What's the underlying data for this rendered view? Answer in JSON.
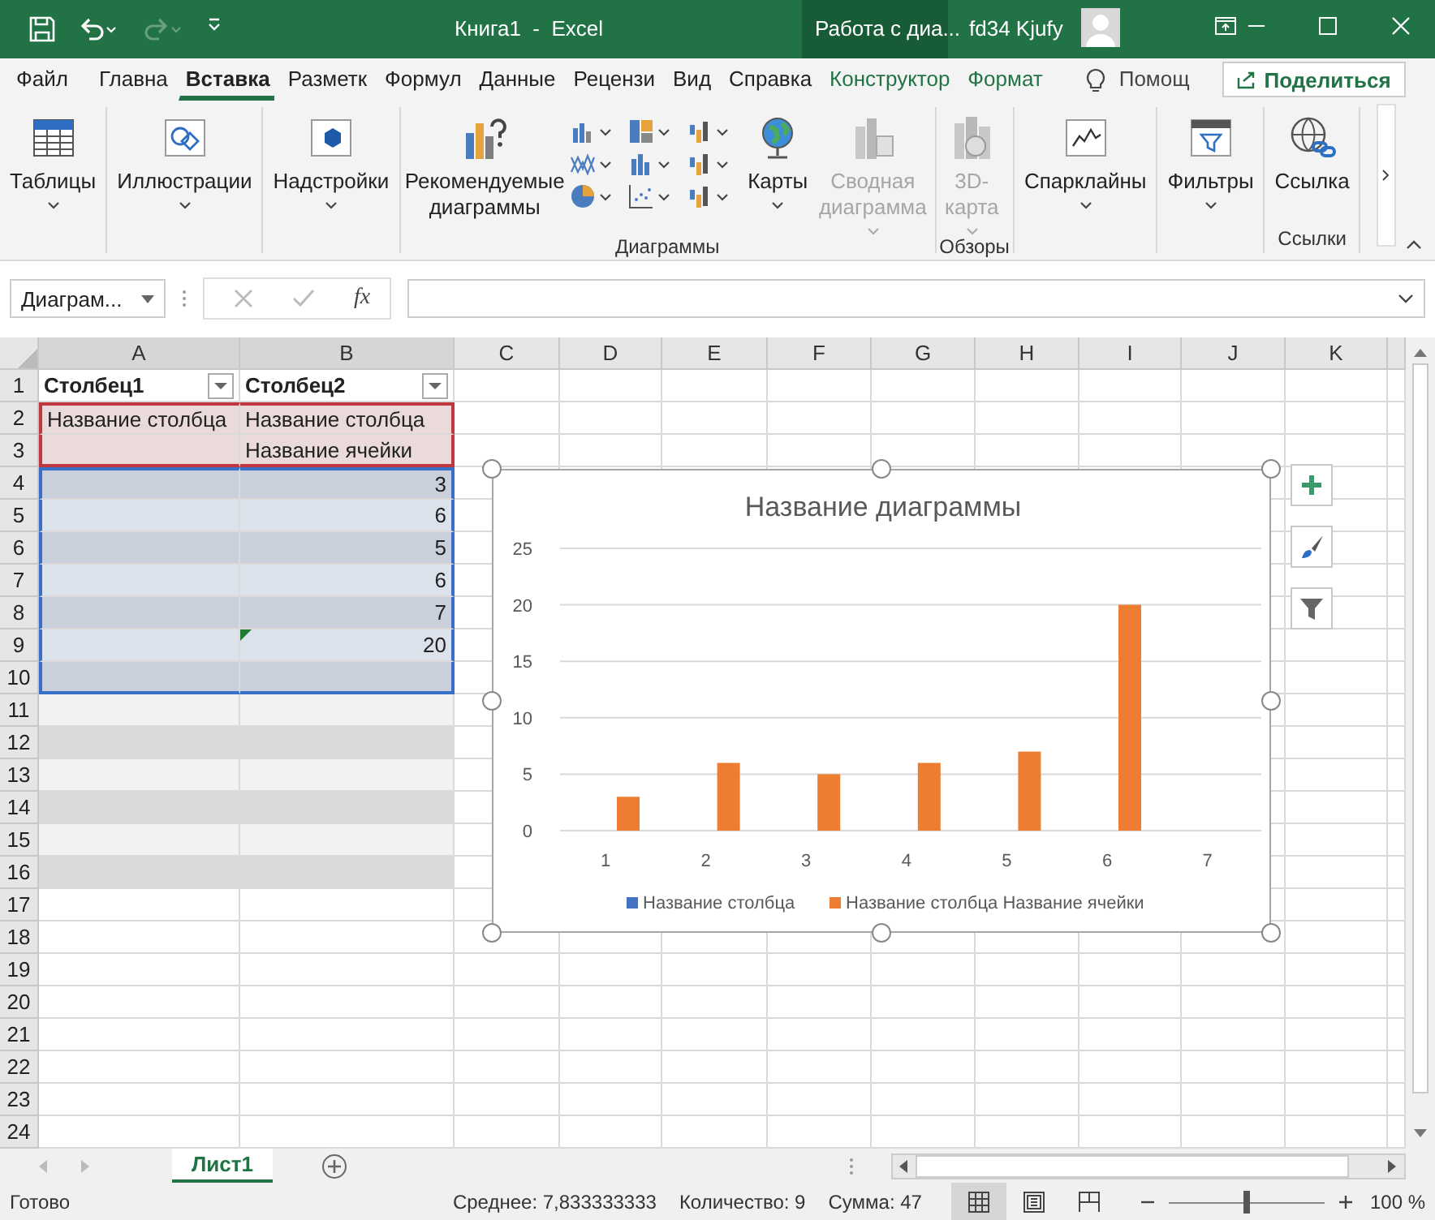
{
  "title_bar": {
    "title": "Книга1  -  Excel",
    "context_label": "Работа с диа...",
    "user": "fd34 Kjufy"
  },
  "tabs": [
    {
      "label": "Файл",
      "kind": "file",
      "selected": false
    },
    {
      "label": "Главна",
      "kind": "normal",
      "selected": false
    },
    {
      "label": "Вставка",
      "kind": "normal",
      "selected": true
    },
    {
      "label": "Разметк",
      "kind": "normal",
      "selected": false
    },
    {
      "label": "Формул",
      "kind": "normal",
      "selected": false
    },
    {
      "label": "Данные",
      "kind": "normal",
      "selected": false
    },
    {
      "label": "Рецензи",
      "kind": "normal",
      "selected": false
    },
    {
      "label": "Вид",
      "kind": "normal",
      "selected": false
    },
    {
      "label": "Справка",
      "kind": "normal",
      "selected": false
    },
    {
      "label": "Конструктор",
      "kind": "contextual",
      "selected": false
    },
    {
      "label": "Формат",
      "kind": "contextual",
      "selected": false
    }
  ],
  "tell_me": "Помощ",
  "share": "Поделиться",
  "ribbon": {
    "groups": [
      {
        "items": [
          {
            "kind": "large",
            "label": "Таблицы",
            "caret": true,
            "disabled": false
          }
        ]
      },
      {
        "items": [
          {
            "kind": "large",
            "label": "Иллюстрации",
            "caret": true,
            "disabled": false
          }
        ]
      },
      {
        "items": [
          {
            "kind": "large",
            "label": "Надстройки",
            "caret": true,
            "disabled": false
          }
        ]
      },
      {
        "label": "Диаграммы",
        "items": [
          {
            "kind": "large",
            "label": "Рекомендуемые диаграммы",
            "caret": false,
            "disabled": false
          },
          {
            "kind": "chart-types"
          },
          {
            "kind": "large",
            "label": "Карты",
            "caret": true,
            "disabled": false
          },
          {
            "kind": "large",
            "label": "Сводная диаграмма",
            "caret": true,
            "disabled": true
          }
        ]
      },
      {
        "label": "Обзоры",
        "items": [
          {
            "kind": "large",
            "label": "3D-карта",
            "caret": true,
            "disabled": true
          }
        ]
      },
      {
        "items": [
          {
            "kind": "large",
            "label": "Спарклайны",
            "caret": true,
            "disabled": false
          }
        ]
      },
      {
        "items": [
          {
            "kind": "large",
            "label": "Фильтры",
            "caret": true,
            "disabled": false
          }
        ]
      },
      {
        "label": "Ссылки",
        "items": [
          {
            "kind": "large",
            "label": "Ссылка",
            "caret": false,
            "disabled": false
          }
        ]
      }
    ]
  },
  "formula_bar": {
    "name_box": "Диаграм...",
    "fx": "fx"
  },
  "sheet": {
    "columns": [
      "A",
      "B",
      "C",
      "D",
      "E",
      "F",
      "G",
      "H",
      "I",
      "J",
      "K"
    ],
    "rows": [
      {
        "header": "1",
        "kind": "header",
        "a": "Столбец1",
        "b": "Столбец2"
      },
      {
        "header": "2",
        "kind": "selected",
        "a": "Название столбца",
        "b": "Название столбца"
      },
      {
        "header": "3",
        "kind": "selected",
        "b": "Название ячейки"
      },
      {
        "header": "4",
        "kind": "data",
        "b": "3"
      },
      {
        "header": "5",
        "kind": "data",
        "b": "6"
      },
      {
        "header": "6",
        "kind": "data",
        "b": "5"
      },
      {
        "header": "7",
        "kind": "data",
        "b": "6"
      },
      {
        "header": "8",
        "kind": "data",
        "b": "7"
      },
      {
        "header": "9",
        "kind": "data",
        "b": "20",
        "warning": true
      },
      {
        "header": "10",
        "kind": "data"
      },
      {
        "header": "11",
        "kind": "table"
      },
      {
        "header": "12",
        "kind": "table"
      },
      {
        "header": "13",
        "kind": "table"
      },
      {
        "header": "14",
        "kind": "table"
      },
      {
        "header": "15",
        "kind": "table"
      },
      {
        "header": "16",
        "kind": "table"
      },
      {
        "header": "17",
        "kind": "plain"
      },
      {
        "header": "18",
        "kind": "plain"
      },
      {
        "header": "19",
        "kind": "plain"
      },
      {
        "header": "20",
        "kind": "plain"
      },
      {
        "header": "21",
        "kind": "plain"
      },
      {
        "header": "22",
        "kind": "plain"
      },
      {
        "header": "23",
        "kind": "plain"
      },
      {
        "header": "24",
        "kind": "plain"
      }
    ],
    "chart": {
      "chart_data": {
        "type": "bar",
        "title": "Название диаграммы",
        "categories": [
          "1",
          "2",
          "3",
          "4",
          "5",
          "6",
          "7"
        ],
        "series": [
          {
            "name": "Название столбца",
            "color": "#4472c4",
            "values": [
              null,
              null,
              null,
              null,
              null,
              null,
              null
            ]
          },
          {
            "name": "Название столбца Название ячейки",
            "color": "#ed7d31",
            "values": [
              3,
              6,
              5,
              6,
              7,
              20,
              null
            ]
          }
        ],
        "ylim": [
          0,
          25
        ],
        "grid": true,
        "yticks": [
          0,
          5,
          10,
          15,
          20,
          25
        ]
      }
    }
  },
  "sheet_tabs": [
    {
      "label": "Лист1",
      "selected": true
    }
  ],
  "status_bar": {
    "mode": "Готово",
    "average": "Среднее: 7,833333333",
    "count": "Количество: 9",
    "sum": "Сумма: 47",
    "views": [
      {
        "kind": "normal",
        "selected": true
      },
      {
        "kind": "page-layout",
        "selected": false
      },
      {
        "kind": "page-break",
        "selected": false
      }
    ],
    "zoom": {
      "level": 0.5,
      "reading": "100 %"
    }
  }
}
